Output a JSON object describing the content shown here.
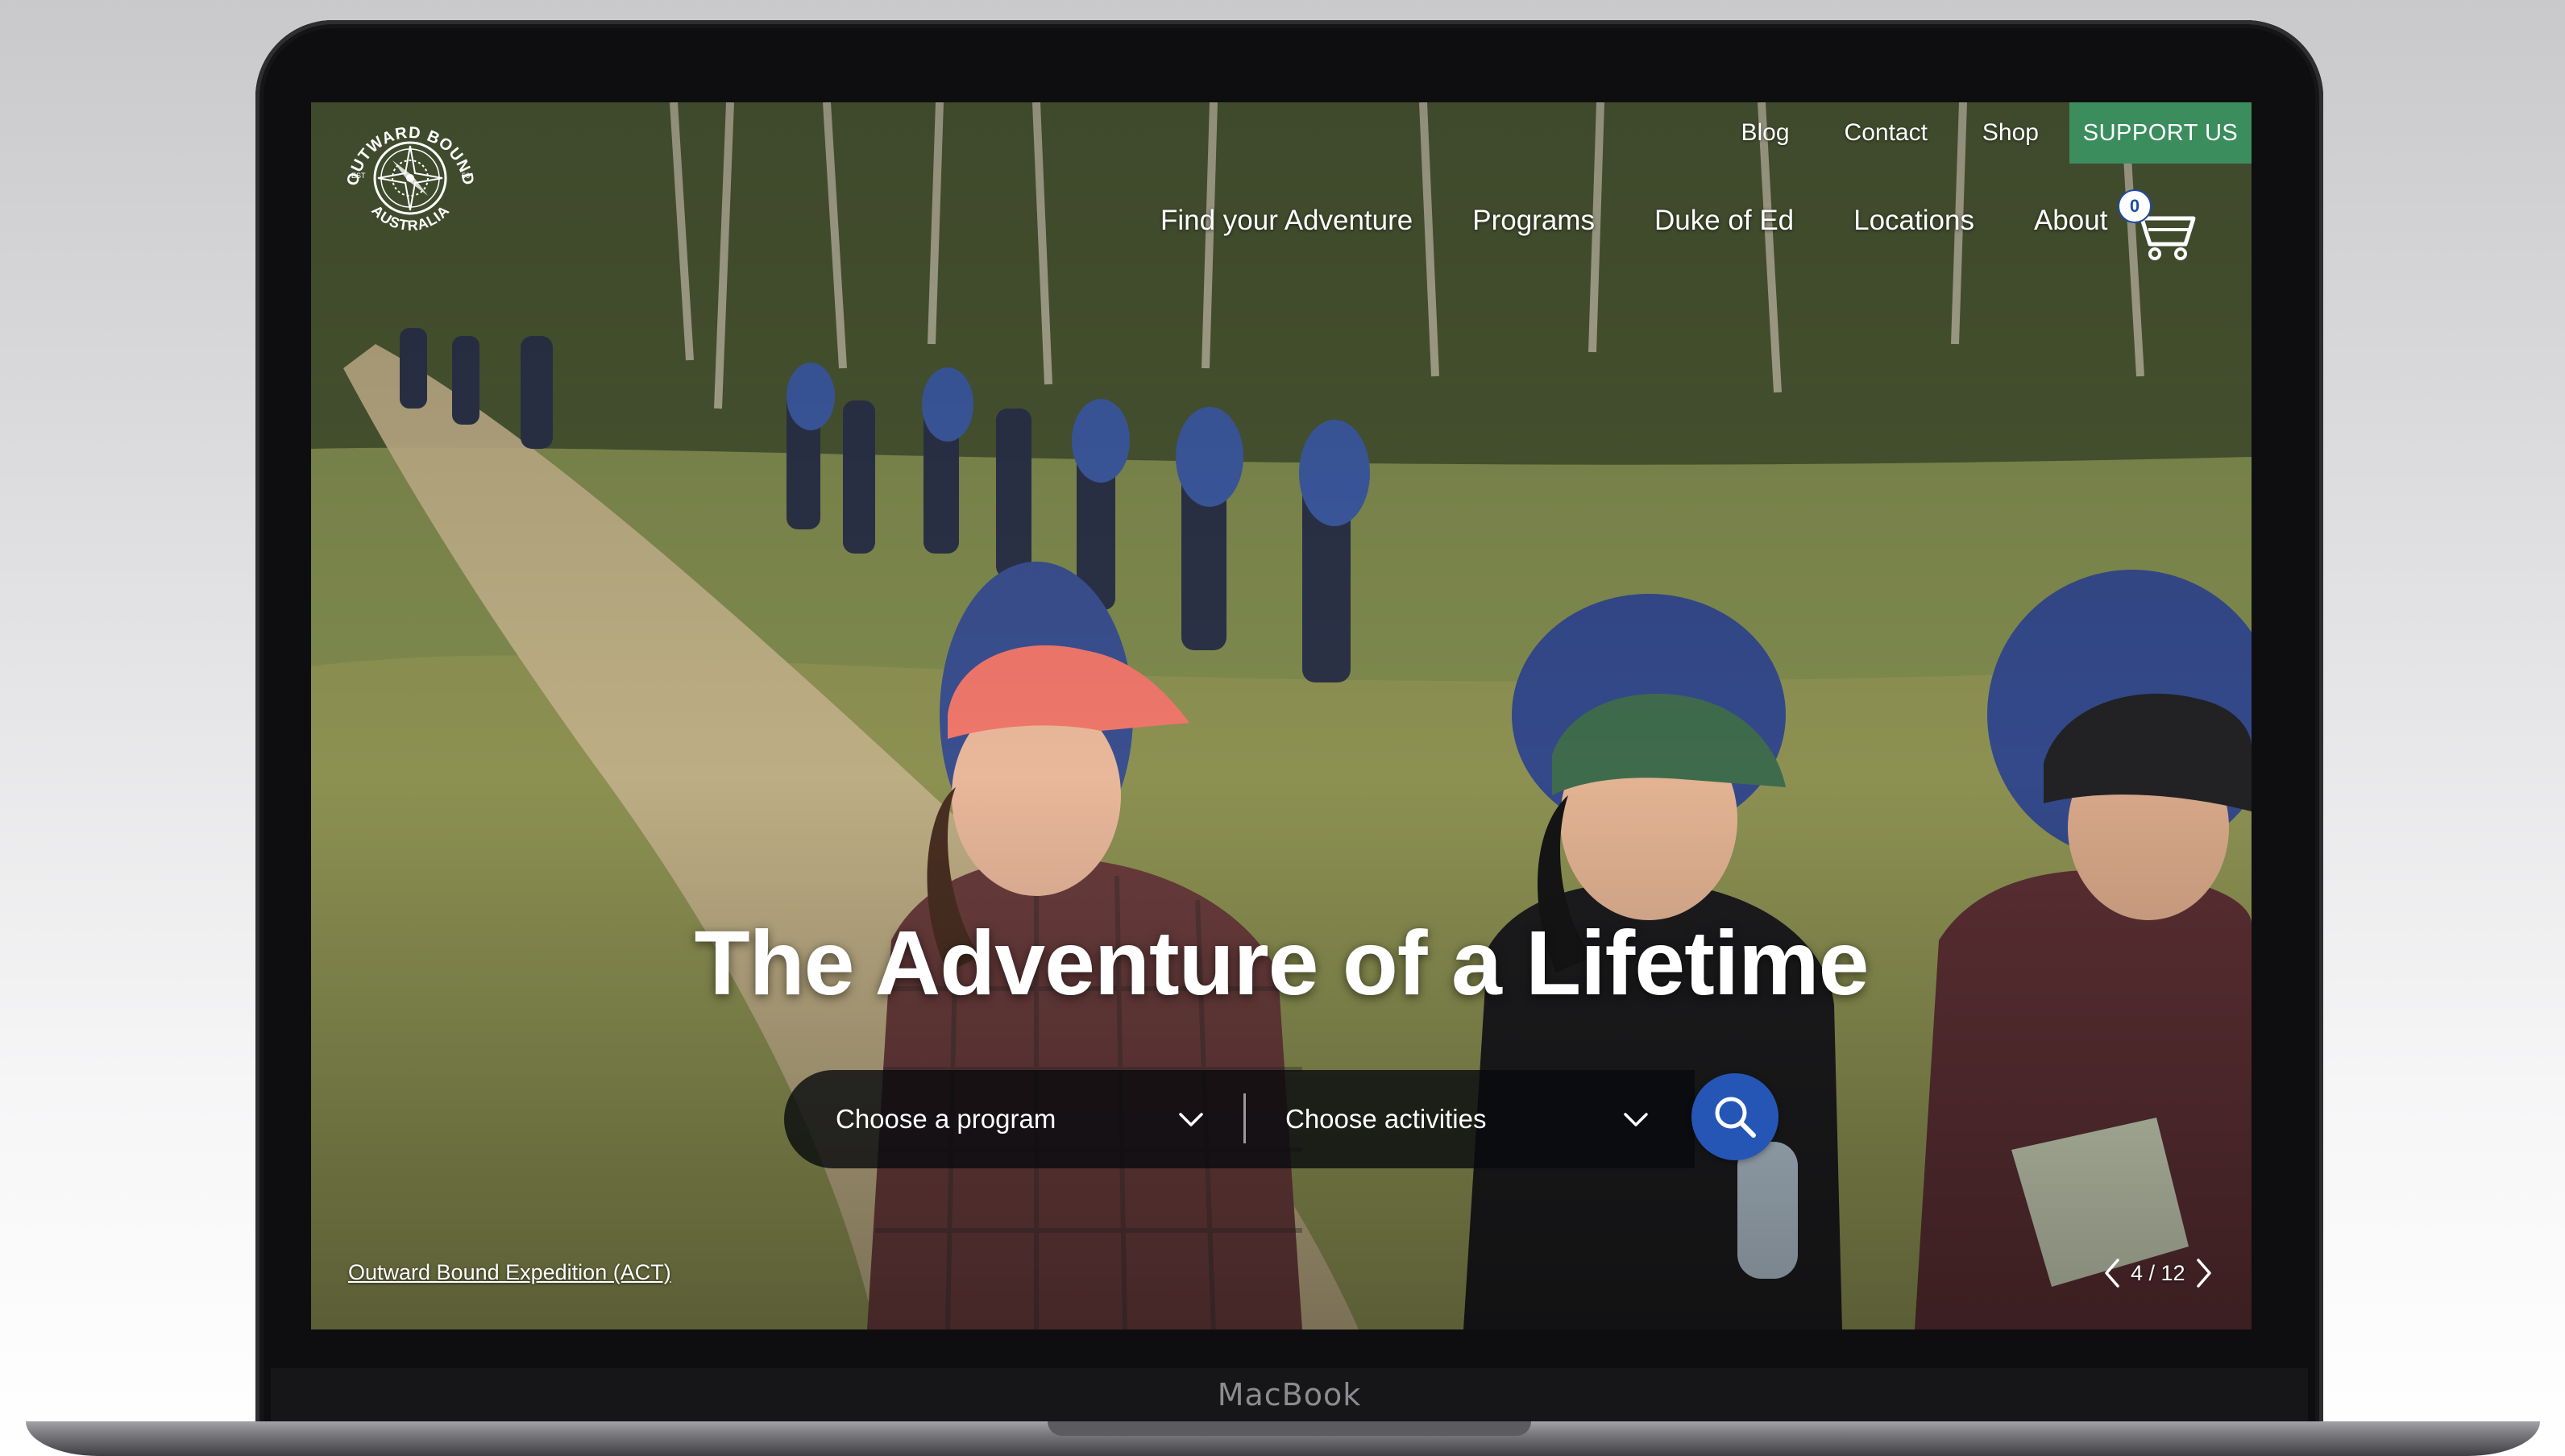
{
  "device": {
    "brand_label": "MacBook"
  },
  "site": {
    "logo": {
      "ring_text_top": "OUTWARD BOUND",
      "ring_text_bottom": "AUSTRALIA",
      "small_left": "EST",
      "small_right": "56"
    },
    "utility_nav": [
      {
        "label": "Blog"
      },
      {
        "label": "Contact"
      },
      {
        "label": "Shop"
      }
    ],
    "support_label": "SUPPORT US",
    "main_nav": [
      {
        "label": "Find your Adventure"
      },
      {
        "label": "Programs"
      },
      {
        "label": "Duke of Ed"
      },
      {
        "label": "Locations"
      },
      {
        "label": "About"
      }
    ],
    "cart_count": "0",
    "hero": {
      "title": "The Adventure of a Lifetime",
      "program_placeholder": "Choose a program",
      "activities_placeholder": "Choose activities",
      "caption": "Outward Bound Expedition (ACT)",
      "slide_counter": "4 / 12"
    },
    "colors": {
      "support_button": "#3b8d5d",
      "search_button": "#2556b6",
      "search_bar": "#0a0c10"
    },
    "icons": {
      "cart": "shopping-cart-icon",
      "search": "search-icon",
      "dropdown": "chevron-down-icon",
      "prev": "chevron-left-icon",
      "next": "chevron-right-icon"
    }
  }
}
